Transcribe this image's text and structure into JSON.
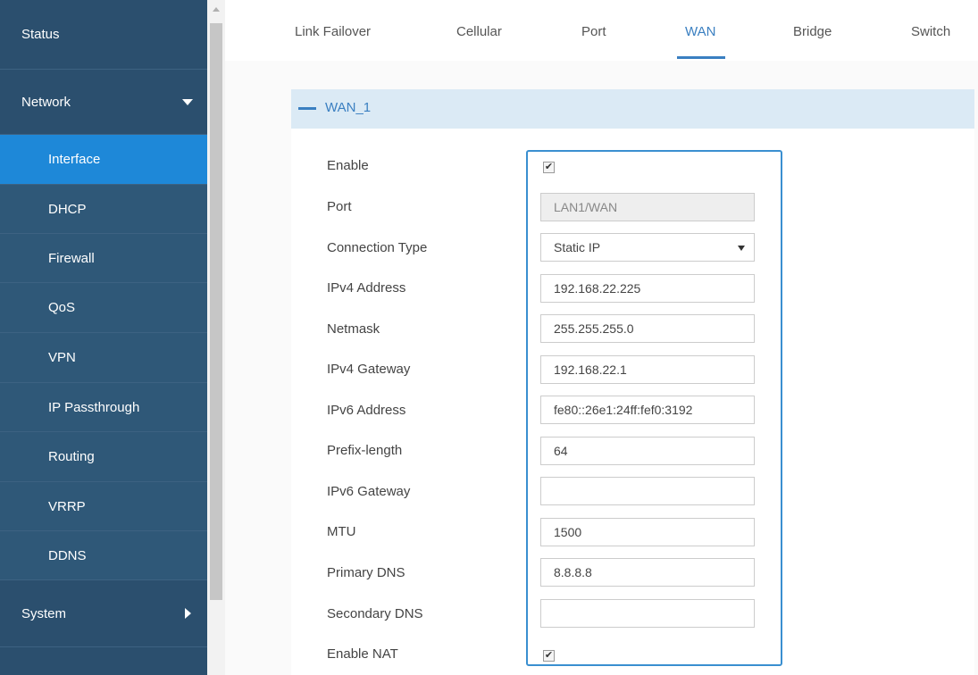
{
  "sidebar": {
    "items": [
      {
        "label": "Status"
      },
      {
        "label": "Network"
      },
      {
        "label": "Interface"
      },
      {
        "label": "DHCP"
      },
      {
        "label": "Firewall"
      },
      {
        "label": "QoS"
      },
      {
        "label": "VPN"
      },
      {
        "label": "IP Passthrough"
      },
      {
        "label": "Routing"
      },
      {
        "label": "VRRP"
      },
      {
        "label": "DDNS"
      },
      {
        "label": "System"
      }
    ]
  },
  "tabs": [
    {
      "label": "Link Failover"
    },
    {
      "label": "Cellular"
    },
    {
      "label": "Port"
    },
    {
      "label": "WAN"
    },
    {
      "label": "Bridge"
    },
    {
      "label": "Switch"
    }
  ],
  "active_tab": "WAN",
  "section": {
    "title": "WAN_1"
  },
  "form": {
    "enable": {
      "label": "Enable",
      "checked": true,
      "mark": "✔"
    },
    "port": {
      "label": "Port",
      "value": "LAN1/WAN"
    },
    "connection_type": {
      "label": "Connection Type",
      "value": "Static IP"
    },
    "ipv4_address": {
      "label": "IPv4 Address",
      "value": "192.168.22.225"
    },
    "netmask": {
      "label": "Netmask",
      "value": "255.255.255.0"
    },
    "ipv4_gateway": {
      "label": "IPv4 Gateway",
      "value": "192.168.22.1"
    },
    "ipv6_address": {
      "label": "IPv6 Address",
      "value": "fe80::26e1:24ff:fef0:3192"
    },
    "prefix_length": {
      "label": "Prefix-length",
      "value": "64"
    },
    "ipv6_gateway": {
      "label": "IPv6 Gateway",
      "value": ""
    },
    "mtu": {
      "label": "MTU",
      "value": "1500"
    },
    "primary_dns": {
      "label": "Primary DNS",
      "value": "8.8.8.8"
    },
    "secondary_dns": {
      "label": "Secondary DNS",
      "value": ""
    },
    "enable_nat": {
      "label": "Enable NAT",
      "checked": true,
      "mark": "✔"
    }
  },
  "colors": {
    "sidebar_bg": "#2b4f6e",
    "sidebar_active": "#1e88d8",
    "accent": "#3a7fc1",
    "section_header_bg": "#dbeaf5"
  }
}
